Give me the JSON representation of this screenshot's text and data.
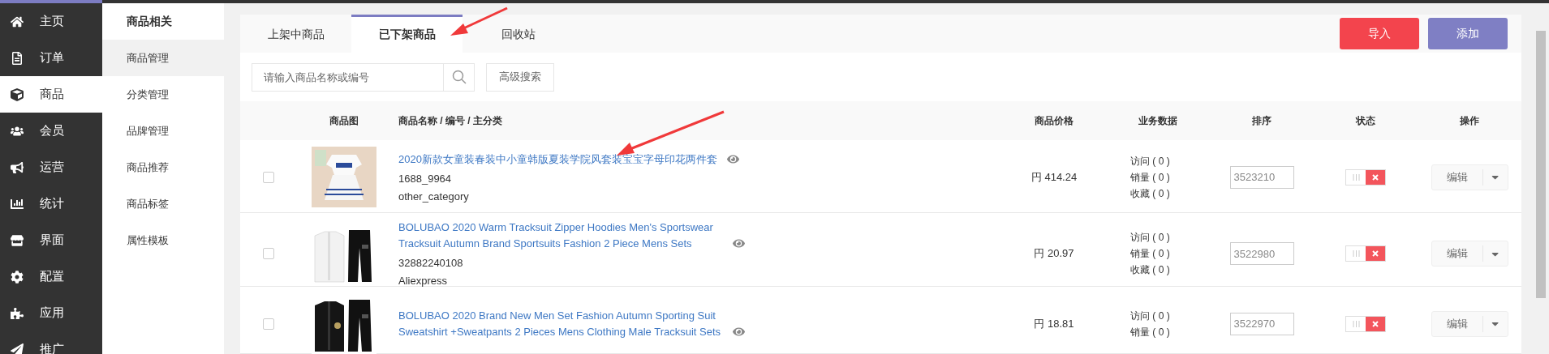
{
  "nav": {
    "items": [
      {
        "label": "主页",
        "selected": false
      },
      {
        "label": "订单",
        "selected": false
      },
      {
        "label": "商品",
        "selected": true
      },
      {
        "label": "会员",
        "selected": false
      },
      {
        "label": "运营",
        "selected": false
      },
      {
        "label": "统计",
        "selected": false
      },
      {
        "label": "界面",
        "selected": false
      },
      {
        "label": "配置",
        "selected": false
      },
      {
        "label": "应用",
        "selected": false
      },
      {
        "label": "推广",
        "selected": false
      }
    ]
  },
  "subnav": {
    "title": "商品相关",
    "items": [
      {
        "label": "商品管理",
        "selected": true
      },
      {
        "label": "分类管理",
        "selected": false
      },
      {
        "label": "品牌管理",
        "selected": false
      },
      {
        "label": "商品推荐",
        "selected": false
      },
      {
        "label": "商品标签",
        "selected": false
      },
      {
        "label": "属性模板",
        "selected": false
      }
    ]
  },
  "tabs": [
    {
      "label": "上架中商品",
      "selected": false
    },
    {
      "label": "已下架商品",
      "selected": true
    },
    {
      "label": "回收站",
      "selected": false
    }
  ],
  "actions": [
    {
      "label": "导入",
      "kind": "danger"
    },
    {
      "label": "添加",
      "kind": "primary"
    }
  ],
  "search": {
    "placeholder": "请输入商品名称或编号",
    "advanced": "高级搜索"
  },
  "table": {
    "columns": [
      "商品图",
      "商品名称 / 编号 / 主分类",
      "商品价格",
      "业务数据",
      "排序",
      "状态",
      "操作"
    ],
    "rows": [
      {
        "checked": false,
        "name": "2020新款女童装春装中小童韩版夏装学院风套装宝宝字母印花两件套",
        "code": "1688_9964",
        "category": "other_category",
        "price": "円 414.24",
        "stats": [
          "访问 ( 0 )",
          "销量 ( 0 )",
          "收藏 ( 0 )"
        ],
        "sort": "3523210",
        "on": false,
        "edit": "编辑"
      },
      {
        "checked": false,
        "name": "BOLUBAO 2020 Warm Tracksuit Zipper Hoodies Men's Sportswear Tracksuit Autumn Brand Sportsuits Fashion 2 Piece Mens Sets",
        "code": "32882240108",
        "category": "Aliexpress",
        "price": "円 20.97",
        "stats": [
          "访问 ( 0 )",
          "销量 ( 0 )",
          "收藏 ( 0 )"
        ],
        "sort": "3522980",
        "on": false,
        "edit": "编辑"
      },
      {
        "checked": false,
        "name": "BOLUBAO 2020 Brand New Men Set Fashion Autumn Sporting Suit Sweatshirt +Sweatpants 2 Pieces Mens Clothing Male Tracksuit Sets",
        "price": "円 18.81",
        "stats": [
          "访问 ( 0 )",
          "销量 ( 0 )"
        ],
        "sort": "3522970",
        "on": false,
        "edit": "编辑"
      }
    ]
  }
}
